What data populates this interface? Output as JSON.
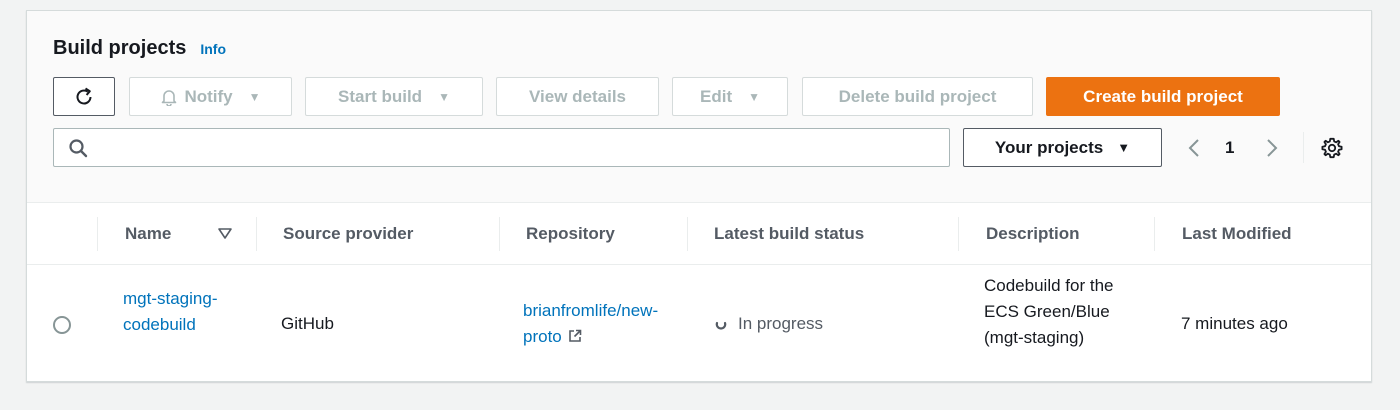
{
  "header": {
    "title": "Build projects",
    "info_link": "Info"
  },
  "toolbar": {
    "refresh_icon": "refresh-icon",
    "notify_label": "Notify",
    "start_build_label": "Start build",
    "view_details_label": "View details",
    "edit_label": "Edit",
    "delete_label": "Delete build project",
    "create_label": "Create build project",
    "accent_color": "#ec7211"
  },
  "filter": {
    "search_placeholder": "",
    "search_value": "",
    "scope_selected": "Your projects"
  },
  "pagination": {
    "current_page": "1"
  },
  "table": {
    "columns": [
      "Name",
      "Source provider",
      "Repository",
      "Latest build status",
      "Description",
      "Last Modified"
    ],
    "rows": [
      {
        "name": "mgt-staging-codebuild",
        "source_provider": "GitHub",
        "repository": "brianfromlife/new-proto",
        "status": "In progress",
        "description": "Codebuild for the ECS Green/Blue (mgt-staging)",
        "last_modified": "7 minutes ago"
      }
    ]
  }
}
